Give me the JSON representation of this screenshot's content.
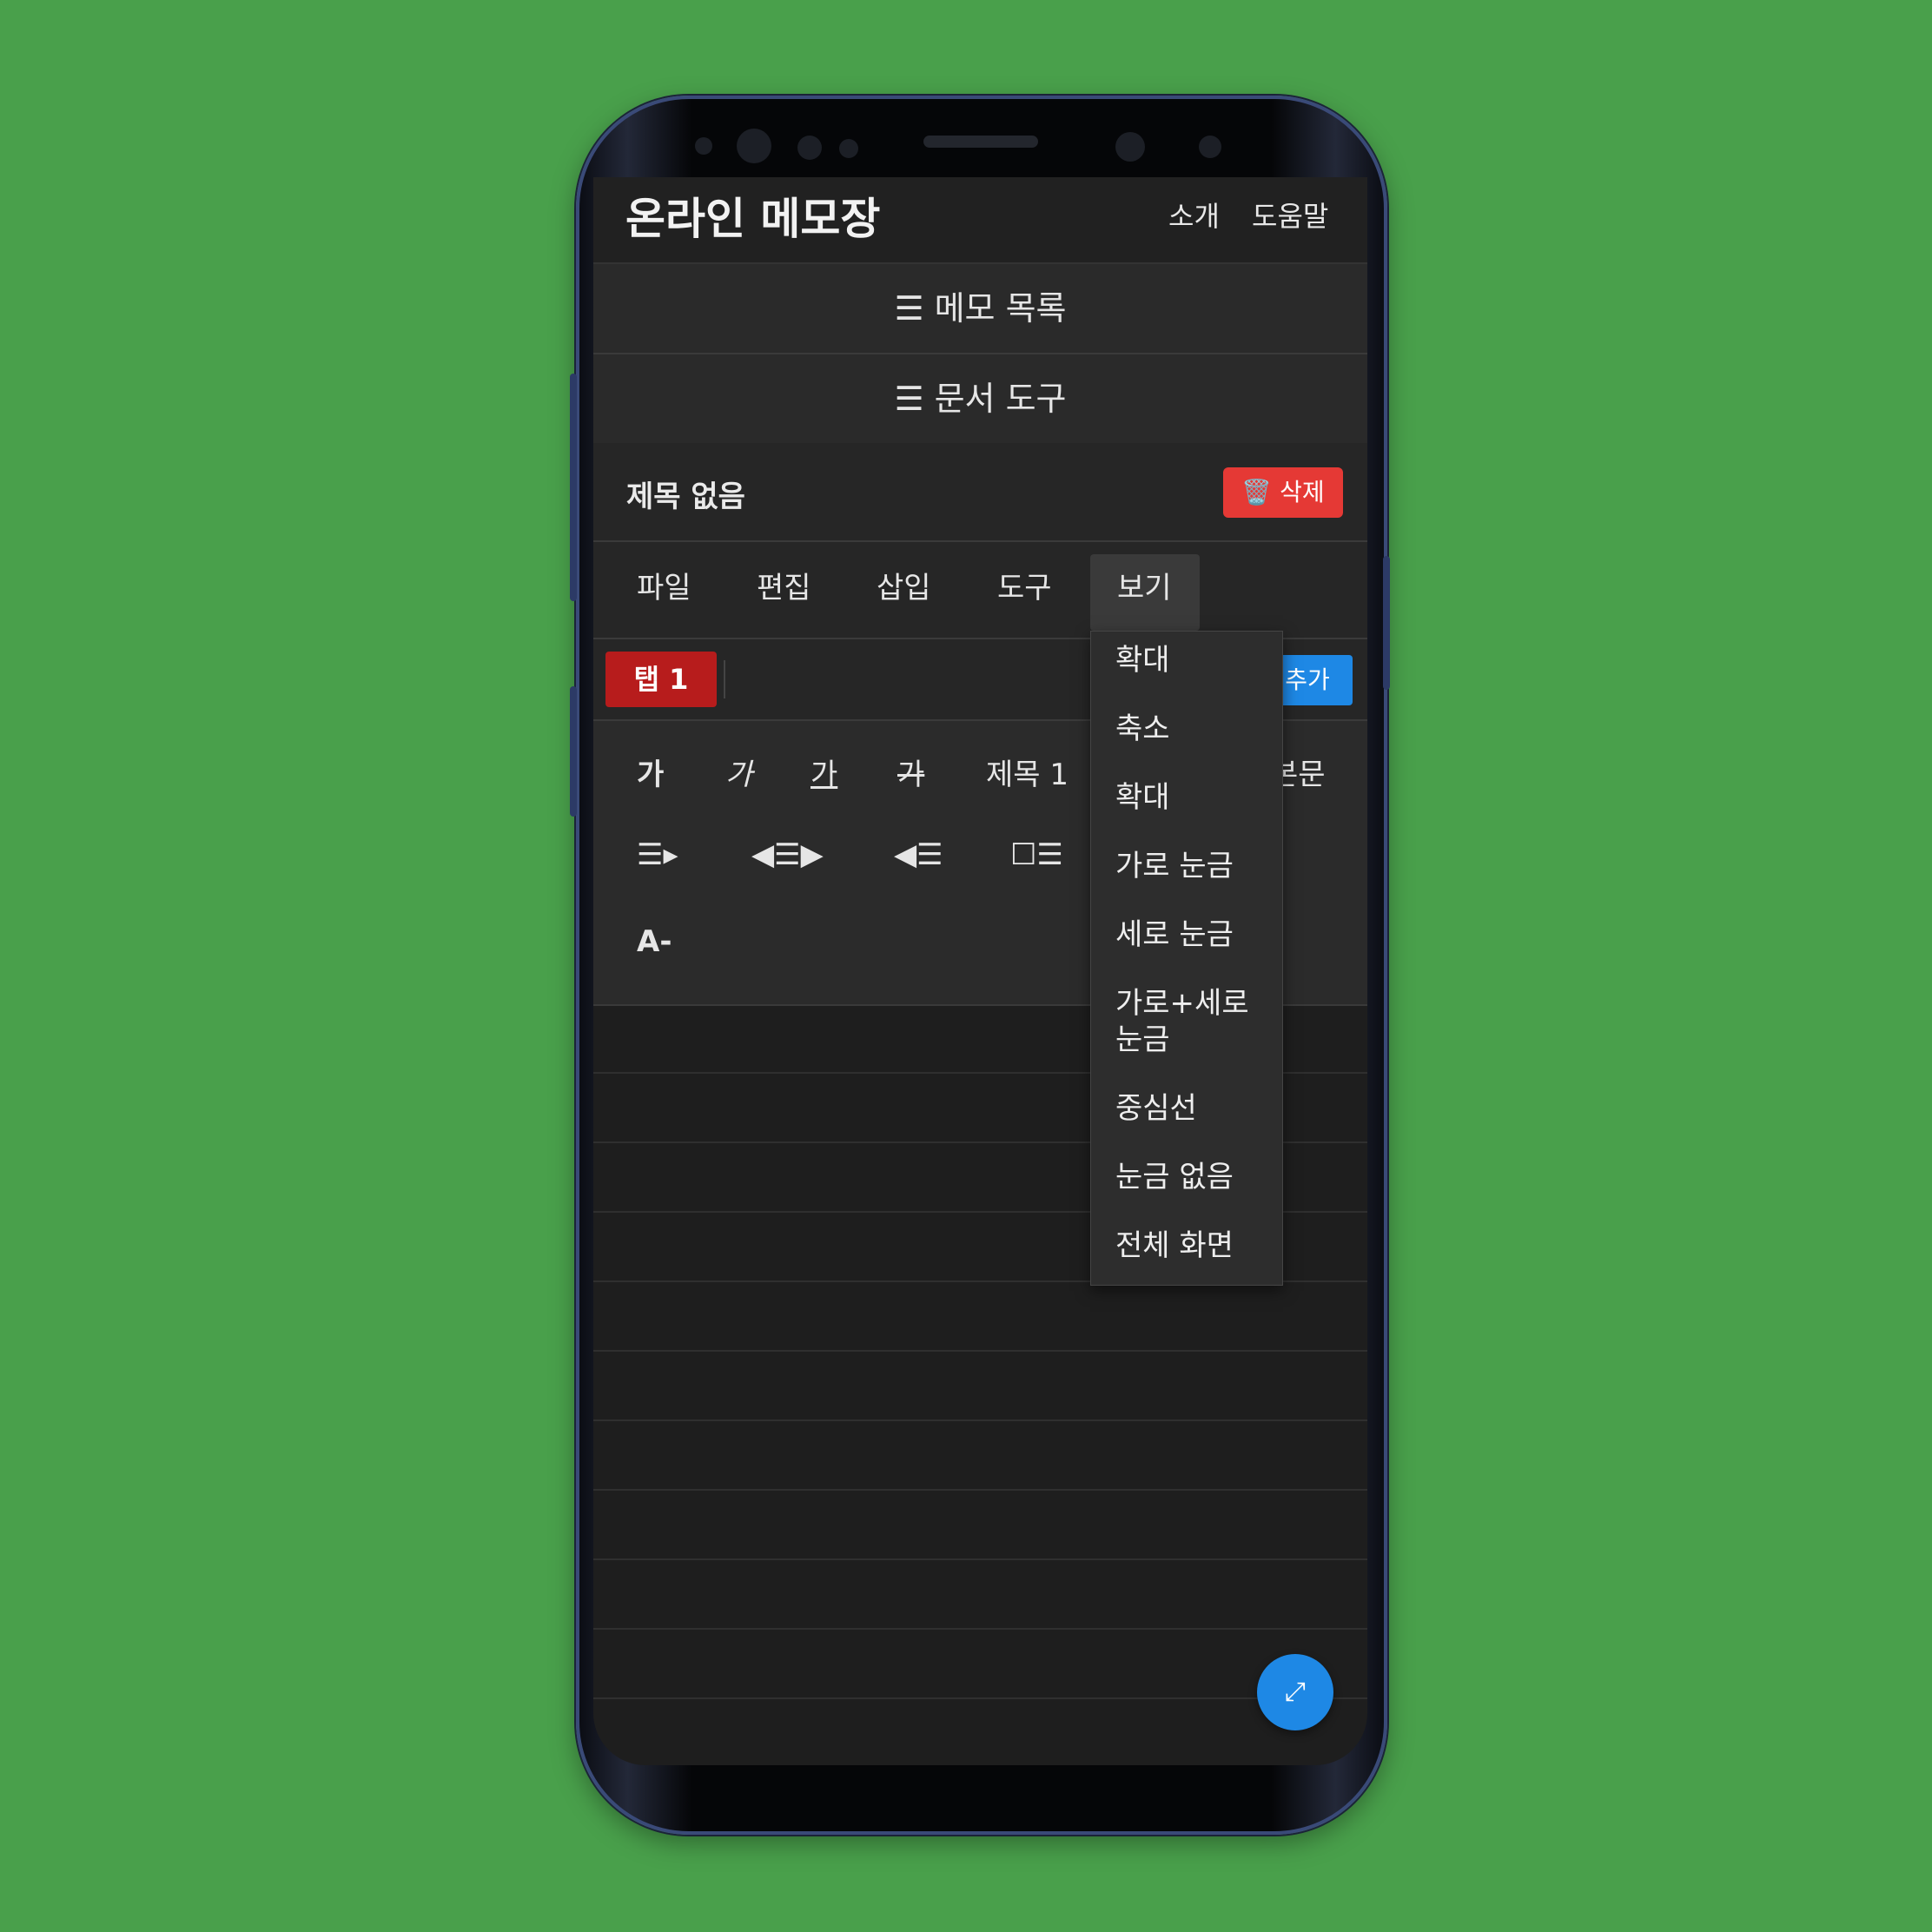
{
  "app": {
    "title": "온라인 메모장"
  },
  "header": {
    "about_label": "소개",
    "help_label": "도움말"
  },
  "memo_list": {
    "label": "☰ 메모 목록"
  },
  "doc_tools": {
    "label": "☰ 문서 도구"
  },
  "document": {
    "title": "제목 없음",
    "delete_label": "🗑️ 삭제"
  },
  "menubar": {
    "items": [
      "파일",
      "편집",
      "삽입",
      "도구",
      "보기"
    ],
    "active": "보기"
  },
  "tabs": {
    "items": [
      "탭 1"
    ],
    "add_label": "추가"
  },
  "toolbar": {
    "row1": [
      "가",
      "가",
      "가",
      "가",
      "제목 1",
      "본문"
    ],
    "row2": [
      "☰▸",
      "◀☰▶",
      "◀☰",
      "☐☰"
    ],
    "row3": [
      "A-"
    ]
  },
  "view_menu": {
    "items": [
      "확대",
      "축소",
      "확대",
      "가로 눈금",
      "세로 눈금",
      "가로+세로 눈금",
      "중심선",
      "눈금 없음",
      "전체 화면"
    ]
  },
  "fab": {
    "icon": "expand-icon",
    "glyph": "⤢"
  },
  "colors": {
    "background": "#49a04b",
    "danger": "#e53935",
    "tab_active": "#b71c1c",
    "accent": "#1e88e5"
  }
}
